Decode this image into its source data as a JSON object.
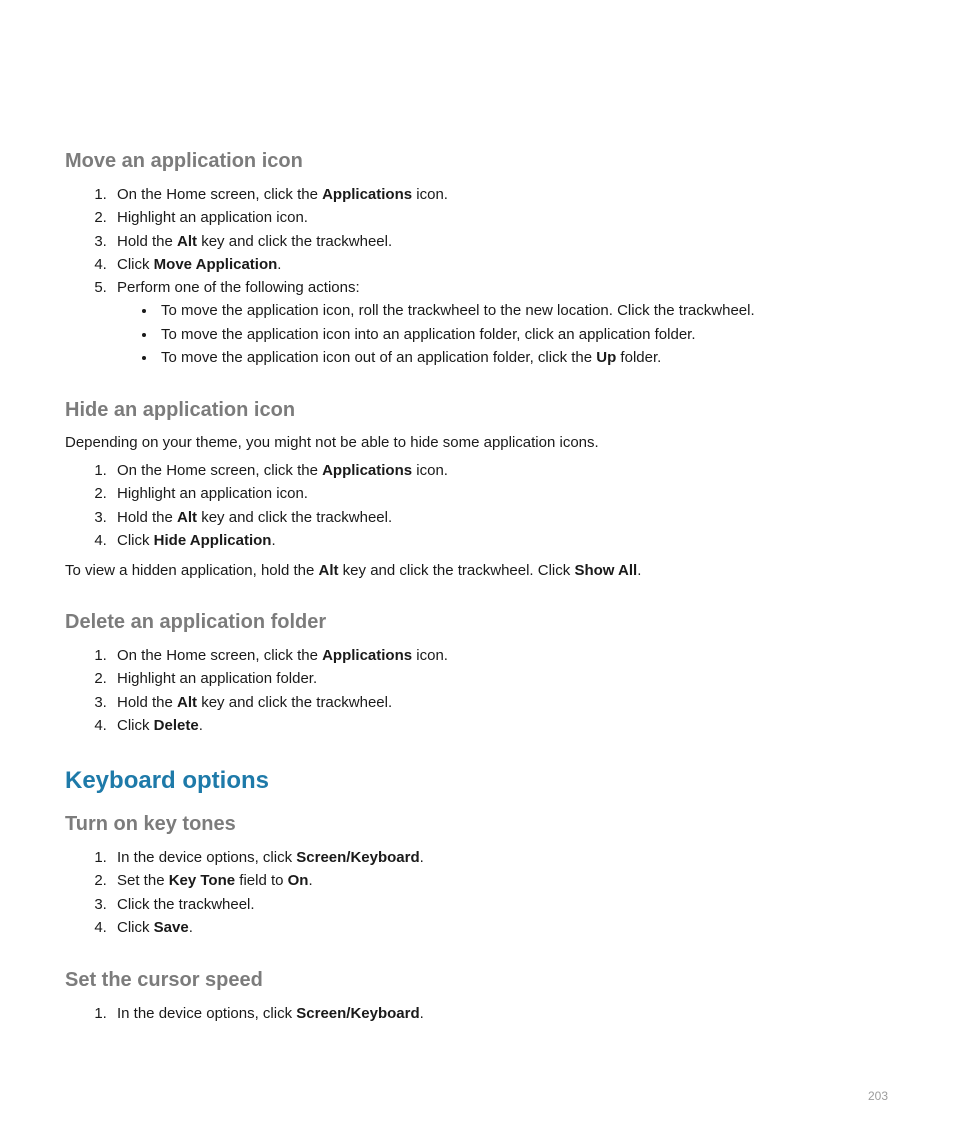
{
  "section1": {
    "heading": "Move an application icon",
    "step1_a": "On the Home screen, click the ",
    "step1_b": "Applications",
    "step1_c": " icon.",
    "step2": "Highlight an application icon.",
    "step3_a": "Hold the ",
    "step3_b": "Alt",
    "step3_c": " key and click the trackwheel.",
    "step4_a": "Click ",
    "step4_b": "Move Application",
    "step4_c": ".",
    "step5": "Perform one of the following actions:",
    "bullet1": "To move the application icon, roll the trackwheel to the new location. Click the trackwheel.",
    "bullet2": "To move the application icon into an application folder, click an application folder.",
    "bullet3_a": "To move the application icon out of an application folder, click the ",
    "bullet3_b": "Up",
    "bullet3_c": " folder."
  },
  "section2": {
    "heading": "Hide an application icon",
    "intro": "Depending on your theme, you might not be able to hide some application icons.",
    "step1_a": "On the Home screen, click the ",
    "step1_b": "Applications",
    "step1_c": " icon.",
    "step2": "Highlight an application icon.",
    "step3_a": "Hold the ",
    "step3_b": "Alt",
    "step3_c": " key and click the trackwheel.",
    "step4_a": "Click ",
    "step4_b": "Hide Application",
    "step4_c": ".",
    "outro_a": "To view a hidden application, hold the ",
    "outro_b": "Alt",
    "outro_c": " key and click the trackwheel. Click ",
    "outro_d": "Show All",
    "outro_e": "."
  },
  "section3": {
    "heading": "Delete an application folder",
    "step1_a": "On the Home screen, click the ",
    "step1_b": "Applications",
    "step1_c": " icon.",
    "step2": "Highlight an application folder.",
    "step3_a": "Hold the ",
    "step3_b": "Alt",
    "step3_c": " key and click the trackwheel.",
    "step4_a": "Click ",
    "step4_b": "Delete",
    "step4_c": "."
  },
  "mainheading": "Keyboard options",
  "section4": {
    "heading": "Turn on key tones",
    "step1_a": "In the device options, click ",
    "step1_b": "Screen/Keyboard",
    "step1_c": ".",
    "step2_a": "Set the ",
    "step2_b": "Key Tone",
    "step2_c": " field to ",
    "step2_d": "On",
    "step2_e": ".",
    "step3": "Click the trackwheel.",
    "step4_a": "Click ",
    "step4_b": "Save",
    "step4_c": "."
  },
  "section5": {
    "heading": "Set the cursor speed",
    "step1_a": "In the device options, click ",
    "step1_b": "Screen/Keyboard",
    "step1_c": "."
  },
  "page_number": "203"
}
